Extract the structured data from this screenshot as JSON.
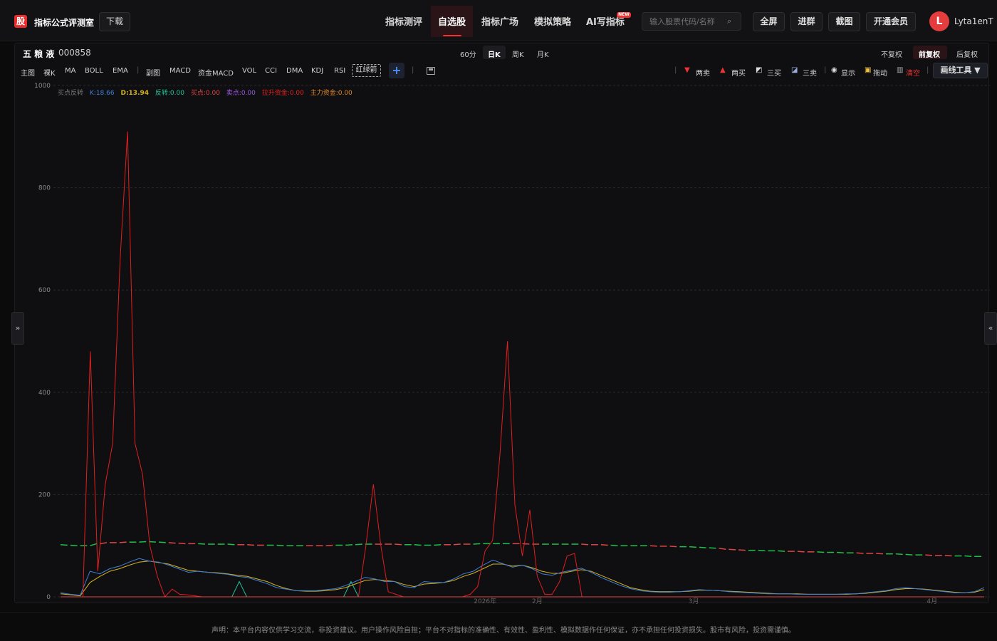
{
  "header": {
    "logo_char": "股",
    "brand": "指标公式评测室",
    "download": "下载",
    "nav": [
      "指标测评",
      "自选股",
      "指标广场",
      "模拟策略",
      "AI写指标"
    ],
    "new_badge": "NEW",
    "search_placeholder": "输入股票代码/名称",
    "search_icon": "⌕",
    "buttons": [
      "全屏",
      "进群",
      "截图",
      "开通会员"
    ],
    "avatar": "L",
    "username": "Lyta1enT"
  },
  "stock": {
    "name": "五 粮 液",
    "code": "000858"
  },
  "periods": [
    "60分",
    "日K",
    "周K",
    "月K"
  ],
  "adjust": [
    "不复权",
    "前复权",
    "后复权"
  ],
  "indicators": [
    "主图",
    "裸K",
    "MA",
    "BOLL",
    "EMA",
    "副图",
    "MACD",
    "资金MACD",
    "VOL",
    "CCI",
    "DMA",
    "KDJ",
    "RSI"
  ],
  "indicator_selected": "红绿箭",
  "plus": "+",
  "tools": {
    "two_sell": "两卖",
    "two_buy": "两买",
    "three_buy": "三买",
    "three_sell": "三卖",
    "show": "显示",
    "drag": "拖动",
    "clear": "清空",
    "draw_tool": "画线工具 ▼"
  },
  "legend": [
    {
      "text": "买点反转",
      "color": "#777777"
    },
    {
      "text": "K:18.66",
      "color": "#3f7fd6"
    },
    {
      "text": "D:13.94",
      "color": "#d4b21e"
    },
    {
      "text": "反转:0.00",
      "color": "#1fc29a"
    },
    {
      "text": "买点:0.00",
      "color": "#e04545"
    },
    {
      "text": "卖点:0.00",
      "color": "#9b59e0"
    },
    {
      "text": "拉升资金:0.00",
      "color": "#e02020"
    },
    {
      "text": "主力资金:0.00",
      "color": "#e08a2a"
    }
  ],
  "side_left": "»",
  "side_right": "«",
  "disclaimer": "声明：本平台内容仅供学习交流，非投资建议。用户操作风险自担；平台不对指标的准确性、有效性、盈利性、模拟数据作任何保证，亦不承担任何投资损失。股市有风险，投资需谨慎。",
  "chart_data": {
    "type": "line",
    "ylim": [
      0,
      1000
    ],
    "y_ticks": [
      1000,
      800,
      600,
      400,
      200,
      0
    ],
    "x_tick_labels": [
      "2026年",
      "2月",
      "3月",
      "4月"
    ],
    "x_tick_index": [
      57,
      64,
      85,
      117
    ],
    "n_points": 125,
    "series": [
      {
        "name": "拉升资金",
        "color": "#e02020",
        "values": [
          0,
          0,
          0,
          0,
          480,
          50,
          220,
          300,
          660,
          910,
          300,
          240,
          100,
          40,
          0,
          15,
          5,
          4,
          2,
          0,
          0,
          0,
          0,
          0,
          0,
          0,
          0,
          0,
          0,
          0,
          0,
          0,
          0,
          0,
          0,
          0,
          0,
          0,
          0,
          0,
          0,
          100,
          220,
          100,
          10,
          5,
          0,
          0,
          0,
          0,
          0,
          0,
          0,
          0,
          0,
          5,
          20,
          90,
          110,
          280,
          500,
          180,
          80,
          170,
          40,
          5,
          5,
          30,
          80,
          85,
          0,
          0,
          0,
          0,
          0,
          0,
          0,
          0,
          0,
          0,
          0,
          0,
          0,
          0,
          0,
          0,
          0,
          0,
          0,
          0,
          0,
          0,
          0,
          0,
          0,
          0,
          0,
          0,
          0,
          0,
          0,
          0,
          0,
          0,
          0,
          0,
          0,
          0,
          0,
          0,
          0,
          0,
          0,
          0,
          0,
          0,
          0,
          0,
          0,
          0,
          0,
          0,
          0,
          0,
          0
        ]
      },
      {
        "name": "K",
        "color": "#3f7fd6",
        "values": [
          8,
          5,
          3,
          50,
          45,
          55,
          60,
          68,
          75,
          70,
          68,
          62,
          55,
          48,
          50,
          48,
          46,
          44,
          40,
          38,
          32,
          26,
          18,
          15,
          12,
          12,
          12,
          14,
          16,
          22,
          30,
          38,
          35,
          30,
          30,
          20,
          18,
          30,
          28,
          28,
          35,
          45,
          50,
          62,
          72,
          65,
          58,
          62,
          55,
          45,
          42,
          48,
          52,
          56,
          48,
          38,
          30,
          22,
          16,
          12,
          10,
          9,
          9,
          10,
          12,
          14,
          13,
          12,
          10,
          9,
          8,
          7,
          6,
          6,
          6,
          5,
          5,
          5,
          5,
          5,
          6,
          6,
          8,
          10,
          12,
          16,
          18,
          16,
          14,
          12,
          10,
          8,
          8,
          10,
          18
        ]
      },
      {
        "name": "D",
        "color": "#d4b21e",
        "values": [
          6,
          4,
          2,
          28,
          40,
          50,
          55,
          62,
          68,
          70,
          67,
          64,
          58,
          52,
          50,
          48,
          47,
          45,
          42,
          40,
          35,
          30,
          22,
          16,
          12,
          11,
          11,
          12,
          14,
          18,
          25,
          32,
          34,
          32,
          30,
          24,
          20,
          25,
          26,
          28,
          32,
          40,
          46,
          55,
          64,
          64,
          60,
          62,
          57,
          50,
          46,
          46,
          50,
          53,
          50,
          42,
          34,
          26,
          18,
          14,
          11,
          10,
          10,
          10,
          11,
          13,
          13,
          12,
          11,
          10,
          9,
          8,
          7,
          6,
          6,
          6,
          5,
          5,
          5,
          5,
          5,
          6,
          7,
          9,
          11,
          14,
          16,
          16,
          15,
          13,
          11,
          9,
          8,
          9,
          14
        ]
      },
      {
        "name": "反转",
        "color": "#1fc29a",
        "values": [
          0,
          0,
          0,
          0,
          0,
          0,
          0,
          0,
          0,
          0,
          0,
          0,
          0,
          0,
          0,
          0,
          0,
          0,
          0,
          0,
          0,
          0,
          0,
          0,
          30,
          0,
          0,
          0,
          0,
          0,
          0,
          0,
          0,
          0,
          0,
          0,
          0,
          0,
          0,
          30,
          0,
          0,
          0,
          0,
          0,
          0,
          0,
          0,
          0,
          0,
          0,
          0,
          0,
          0,
          0,
          0,
          0,
          0,
          0,
          0,
          0,
          0,
          0,
          0,
          0,
          0,
          0,
          0,
          0,
          0,
          0,
          0,
          0,
          0,
          0,
          0,
          0,
          0,
          0,
          0,
          0,
          0,
          0,
          0,
          0,
          0,
          0,
          0,
          0,
          0,
          0,
          0,
          0,
          0,
          0,
          0,
          0,
          0,
          0,
          0,
          0,
          0,
          0,
          0,
          0,
          0,
          0,
          0,
          0,
          0,
          0,
          0,
          0,
          0,
          0,
          0,
          0,
          0,
          0,
          0,
          0,
          0,
          0,
          0,
          0
        ]
      }
    ],
    "baseline_price": {
      "values": [
        102,
        101,
        100,
        100,
        104,
        106,
        106,
        107,
        107,
        108,
        107,
        106,
        105,
        104,
        104,
        103,
        103,
        103,
        102,
        102,
        101,
        101,
        101,
        100,
        100,
        100,
        100,
        100,
        101,
        101,
        102,
        103,
        103,
        103,
        103,
        102,
        102,
        101,
        101,
        102,
        102,
        103,
        103,
        104,
        104,
        104,
        104,
        104,
        103,
        103,
        103,
        103,
        103,
        103,
        102,
        102,
        101,
        100,
        100,
        100,
        100,
        99,
        99,
        98,
        98,
        97,
        96,
        95,
        93,
        92,
        91,
        91,
        90,
        90,
        89,
        89,
        88,
        88,
        87,
        87,
        86,
        86,
        85,
        85,
        84,
        84,
        83,
        82,
        82,
        81,
        81,
        80,
        80,
        79,
        79
      ]
    }
  }
}
